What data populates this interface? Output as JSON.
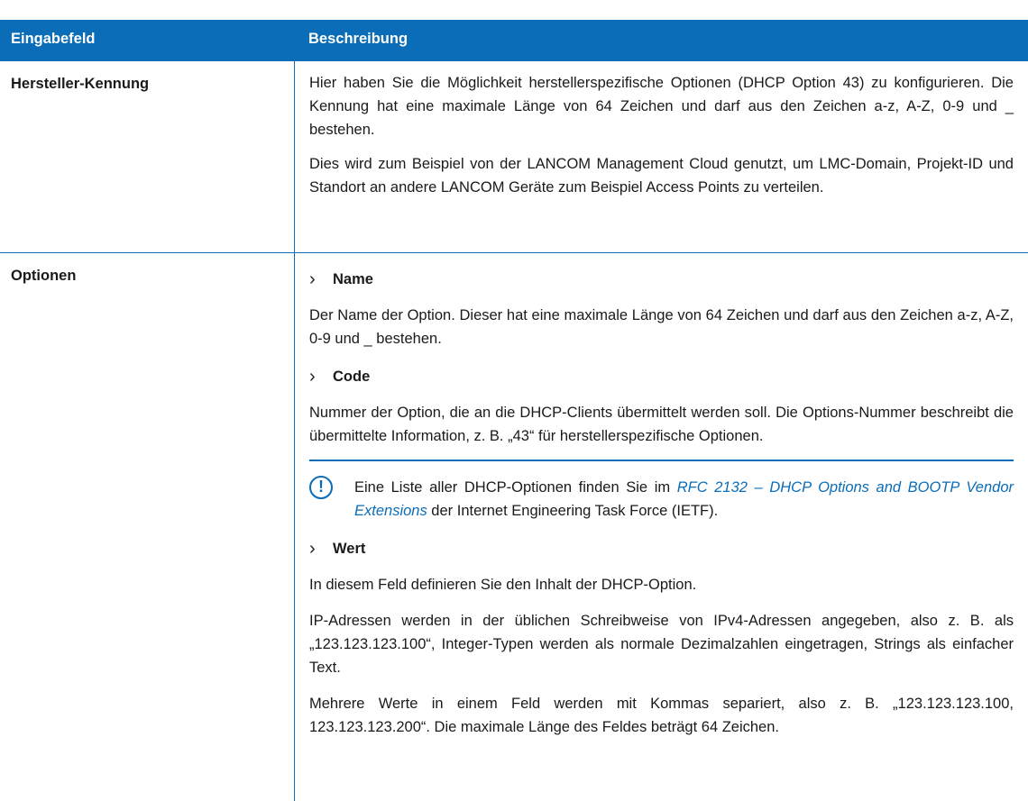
{
  "table": {
    "headers": [
      "Eingabefeld",
      "Beschreibung"
    ],
    "rows": {
      "hersteller": {
        "field": "Hersteller-Kennung",
        "paragraphs": [
          "Hier haben Sie die Möglichkeit herstellerspezifische Optionen (DHCP Option 43) zu konfigurieren. Die Kennung hat eine maximale Länge von 64 Zeichen und darf aus den Zeichen a-z, A-Z, 0-9 und _ bestehen.",
          "Dies wird zum Beispiel von der LANCOM Management Cloud genutzt, um LMC-Domain, Projekt-ID und Standort an andere LANCOM Geräte zum Beispiel Access Points zu verteilen."
        ]
      },
      "optionen": {
        "field": "Optionen",
        "items": {
          "name": {
            "title": "Name",
            "body": "Der Name der Option. Dieser hat eine maximale Länge von 64 Zeichen und darf aus den Zeichen a-z, A-Z, 0-9 und _ bestehen."
          },
          "code": {
            "title": "Code",
            "body": "Nummer der Option, die an die DHCP-Clients übermittelt werden soll. Die Options-Nummer beschreibt die übermittelte Information, z. B. „43“ für herstellerspezifische Optionen.",
            "note": {
              "prefix": "Eine Liste aller DHCP-Optionen finden Sie im ",
              "link": "RFC 2132 – DHCP Options and BOOTP Vendor Extensions",
              "suffix": " der Internet Engineering Task Force (IETF)."
            }
          },
          "wert": {
            "title": "Wert",
            "paragraphs": [
              "In diesem Feld definieren Sie den Inhalt der DHCP-Option.",
              "IP-Adressen werden in der üblichen Schreibweise von IPv4-Adressen angegeben, also z. B. als „123.123.123.100“, Integer-Typen werden als normale Dezimalzahlen eingetragen, Strings als einfacher Text.",
              "Mehrere Werte in einem Feld werden mit Kommas separiert, also z. B. „123.123.123.100, 123.123.123.200“. Die maximale Länge des Feldes beträgt 64 Zeichen."
            ]
          }
        }
      }
    }
  },
  "icons": {
    "bullet": "chevron-right-icon",
    "note": "exclamation-circle-icon"
  },
  "colors": {
    "accent": "#0b6db7"
  }
}
